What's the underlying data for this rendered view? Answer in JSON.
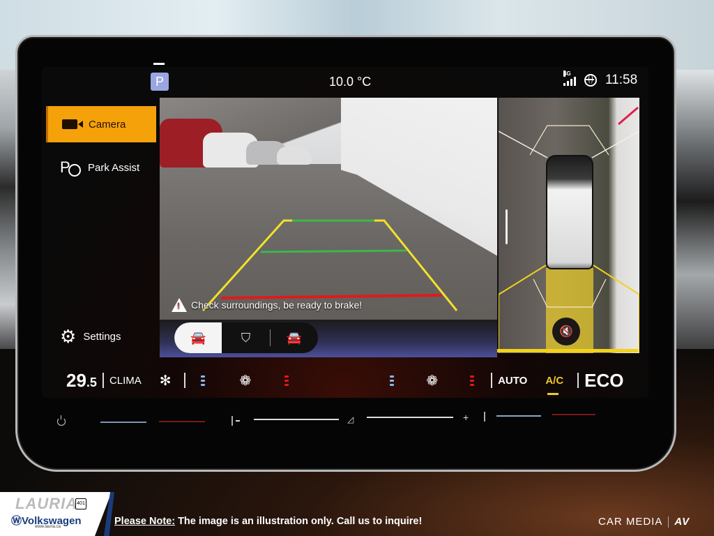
{
  "status_bar": {
    "gear": "P",
    "outside_temp": "10.0 °C",
    "network": "4G",
    "time": "11:58"
  },
  "sidebar": {
    "items": [
      {
        "label": "Camera",
        "icon": "camera-icon",
        "active": true
      },
      {
        "label": "Park Assist",
        "icon": "park-assist-icon",
        "active": false
      },
      {
        "label": "Settings",
        "icon": "gear-icon",
        "active": false
      }
    ]
  },
  "camera": {
    "warning": "Check surroundings, be ready to brake!",
    "view_modes": [
      {
        "name": "rear-view",
        "active": true
      },
      {
        "name": "trailer-view",
        "active": false
      },
      {
        "name": "surround-view",
        "active": false
      }
    ]
  },
  "top_view": {
    "mute_icon": "sound-off-icon"
  },
  "climate": {
    "temperature_whole": "29",
    "temperature_decimal": ".5",
    "clima_label": "CLIMA",
    "auto_label": "AUTO",
    "ac_label": "A/C",
    "eco_label": "ECO",
    "left_seat_cool_level": 3,
    "left_seat_heat_level": 3,
    "right_seat_cool_level": 3,
    "right_seat_heat_level": 3
  },
  "colors": {
    "accent": "#f5a10a",
    "ac_active": "#f0c630",
    "guide_yellow": "#f2e12a",
    "guide_green": "#3bb84a",
    "guide_red": "#e01a1a",
    "cool": "#8ab8e8",
    "heat": "#e01a1a"
  },
  "footer": {
    "dealer_top": "LAURIA",
    "dealer_badge": "401",
    "dealer_brand": "Volkswagen",
    "dealer_url": "www.lauria.ca",
    "note_label": "Please Note:",
    "note_text": " The image is an illustration only. Call us to inquire!",
    "brand": "CAR MEDIA",
    "brand_mark": "AV"
  }
}
